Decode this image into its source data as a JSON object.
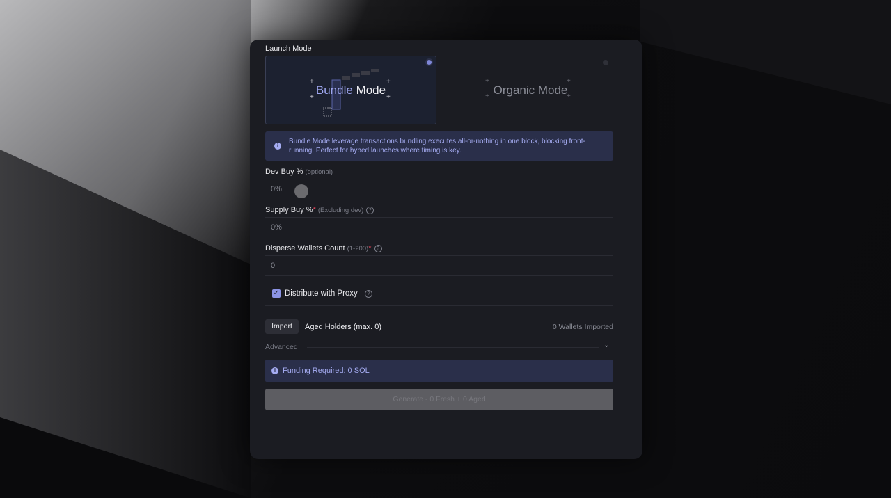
{
  "launch_mode": {
    "label": "Launch Mode",
    "bundle": {
      "accent": "Bundle",
      "rest": "Mode"
    },
    "organic": "Organic Mode"
  },
  "info": {
    "text": "Bundle Mode leverage transactions bundling executes all-or-nothing in one block, blocking front-running. Perfect for hyped launches where timing is key."
  },
  "dev_buy": {
    "label": "Dev Buy %",
    "hint": "(optional)",
    "value": "0%"
  },
  "supply_buy": {
    "label": "Supply Buy %",
    "required": "*",
    "hint": "(Excluding dev)",
    "value": "0%"
  },
  "disperse": {
    "label": "Disperse Wallets Count",
    "hint": "(1-200)",
    "required": "*",
    "value": "0"
  },
  "proxy": {
    "label": "Distribute with Proxy",
    "checked": true
  },
  "holders": {
    "import_label": "Import",
    "title": "Aged Holders (max. 0)",
    "imported": "0 Wallets Imported"
  },
  "advanced": {
    "label": "Advanced"
  },
  "funding": {
    "text": "Funding Required: 0 SOL"
  },
  "generate": {
    "label": "Generate - 0 Fresh + 0 Aged"
  },
  "colors": {
    "accent": "#9fa7f0",
    "info_bg": "#2a2f4a",
    "panel": "#1b1c22"
  },
  "icons": {
    "info": "info-icon",
    "help": "question-icon",
    "check": "check-icon",
    "chevron": "chevron-down-icon"
  }
}
